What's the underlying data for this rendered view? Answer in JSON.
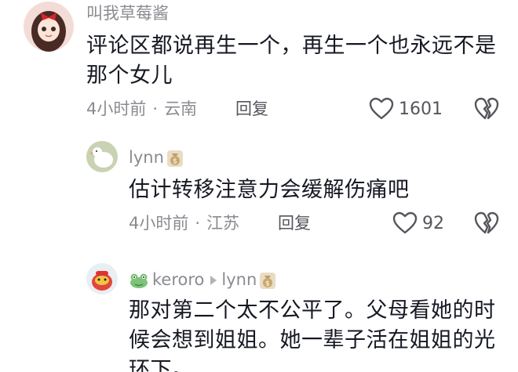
{
  "comments": [
    {
      "username": "叫我草莓酱",
      "content_line1": "评论区都说再生一个，再生一个也永远不是",
      "content_line2": "那个女儿",
      "time": "4小时前",
      "location": "云南",
      "reply_label": "回复",
      "likes": "1601"
    },
    {
      "username": "lynn",
      "content": "估计转移注意力会缓解伤痛吧",
      "time": "4小时前",
      "location": "江苏",
      "reply_label": "回复",
      "likes": "92"
    },
    {
      "username": "keroro",
      "reply_to": "lynn",
      "content_line1": "那对第二个太不公平了。父母看她的时",
      "content_line2": "候会想到姐姐。她一辈子活在姐姐的光",
      "content_line3": "环下。"
    }
  ],
  "separator": "·",
  "colors": {
    "secondary_text": "#8a8b91",
    "primary_text": "#161823",
    "icon": "#55565c"
  },
  "icons": [
    "heart-icon",
    "broken-heart-icon",
    "money-bag-icon",
    "reply-arrow-icon"
  ]
}
